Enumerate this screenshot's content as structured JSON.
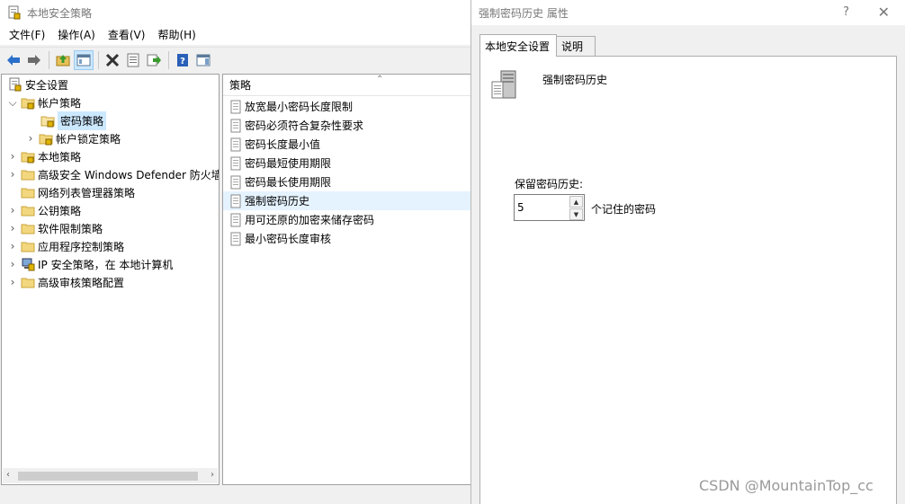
{
  "main_window": {
    "title": "本地安全策略",
    "menu": [
      "文件(F)",
      "操作(A)",
      "查看(V)",
      "帮助(H)"
    ]
  },
  "tree": {
    "root": "安全设置",
    "account_policies": "帐户策略",
    "password_policy": "密码策略",
    "lockout_policy": "帐户锁定策略",
    "local_policies": "本地策略",
    "defender_firewall": "高级安全 Windows Defender 防火墙",
    "network_list": "网络列表管理器策略",
    "public_key": "公钥策略",
    "software_restriction": "软件限制策略",
    "app_control": "应用程序控制策略",
    "ipsec": "IP 安全策略，在 本地计算机",
    "audit_config": "高级审核策略配置"
  },
  "list": {
    "header": "策略",
    "items": [
      "放宽最小密码长度限制",
      "密码必须符合复杂性要求",
      "密码长度最小值",
      "密码最短使用期限",
      "密码最长使用期限",
      "强制密码历史",
      "用可还原的加密来储存密码",
      "最小密码长度审核"
    ]
  },
  "dialog": {
    "title": "强制密码历史 属性",
    "help": "?",
    "close": "✕",
    "tabs": [
      "本地安全设置",
      "说明"
    ],
    "policy_name": "强制密码历史",
    "field_label": "保留密码历史:",
    "field_value": "5",
    "unit": "个记住的密码"
  },
  "watermark": "CSDN @MountainTop_cc",
  "colors": {
    "selection": "#cce8ff",
    "toolbar_blue": "#2a6fc9"
  }
}
